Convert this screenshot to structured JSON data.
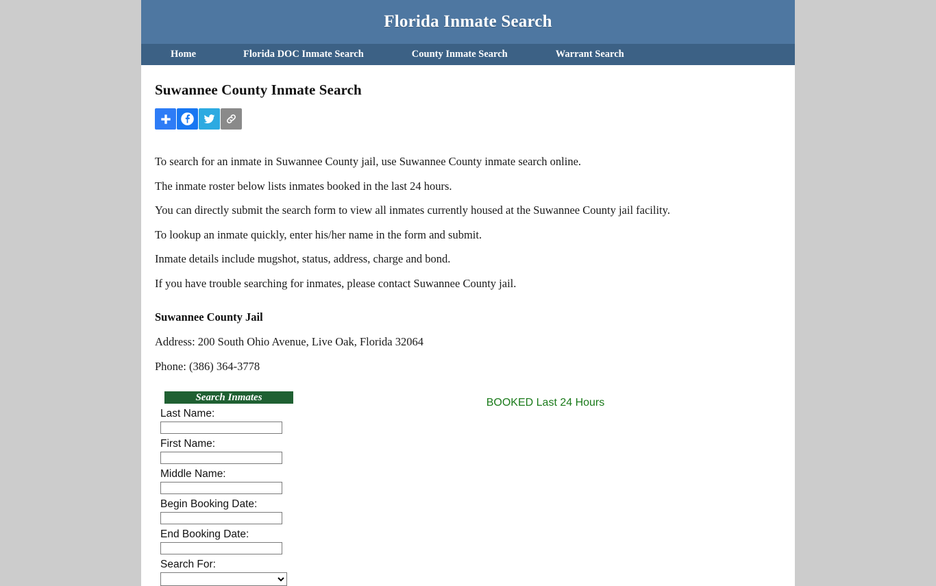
{
  "site": {
    "title": "Florida Inmate Search",
    "header_bg": "#4e77a1",
    "nav_bg": "#3c6185",
    "page_bg": "#cccccc"
  },
  "nav": {
    "items": [
      {
        "label": "Home"
      },
      {
        "label": "Florida DOC Inmate Search"
      },
      {
        "label": "County Inmate Search"
      },
      {
        "label": "Warrant Search"
      }
    ]
  },
  "main": {
    "page_title": "Suwannee County Inmate Search",
    "paragraphs": [
      "To search for an inmate in Suwannee County jail, use Suwannee County inmate search online.",
      "The inmate roster below lists inmates booked in the last 24 hours.",
      "You can directly submit the search form to view all inmates currently housed at the Suwannee County jail facility.",
      "To lookup an inmate quickly, enter his/her name in the form and submit.",
      "Inmate details include mugshot, status, address, charge and bond.",
      "If you have trouble searching for inmates, please contact Suwannee County jail."
    ]
  },
  "jail": {
    "name": "Suwannee County Jail",
    "address": "Address: 200 South Ohio Avenue, Live Oak, Florida 32064",
    "phone": "Phone: (386) 364-3778"
  },
  "share": {
    "buttons": [
      {
        "name": "addthis-share-icon",
        "label": "Share",
        "color": "#2e7cf6"
      },
      {
        "name": "facebook-icon",
        "label": "Facebook",
        "color": "#1877f2"
      },
      {
        "name": "twitter-icon",
        "label": "Twitter",
        "color": "#2daae1"
      },
      {
        "name": "copy-link-icon",
        "label": "Copy Link",
        "color": "#8a8a8a"
      }
    ]
  },
  "search_form": {
    "heading": "Search Inmates",
    "heading_bg": "#1f6032",
    "fields": [
      {
        "label": "Last Name:",
        "value": "",
        "placeholder": ""
      },
      {
        "label": "First Name:",
        "value": "",
        "placeholder": ""
      },
      {
        "label": "Middle Name:",
        "value": "",
        "placeholder": ""
      },
      {
        "label": "Begin Booking Date:",
        "value": "",
        "placeholder": ""
      },
      {
        "label": "End Booking Date:",
        "value": "",
        "placeholder": ""
      }
    ],
    "search_for_label": "Search For:",
    "search_for_value": ""
  },
  "roster": {
    "heading": "BOOKED Last 24 Hours",
    "heading_color": "#1a7a1a"
  }
}
